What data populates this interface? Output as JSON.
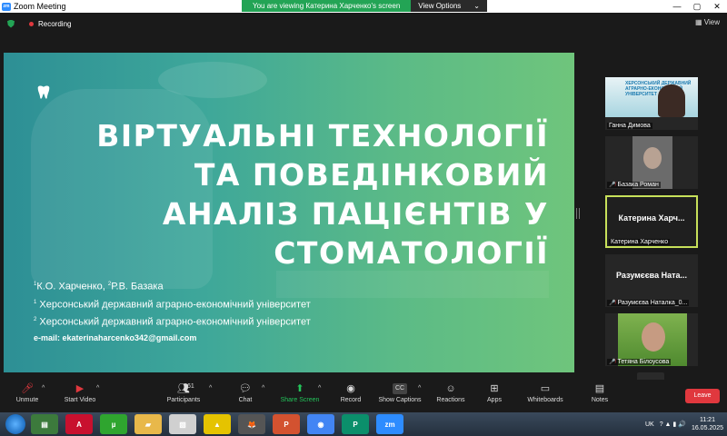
{
  "window": {
    "title": "Zoom Meeting",
    "banner_msg": "You are viewing Катерина Харченко's screen",
    "view_options": "View Options",
    "view_options_caret": "⌄",
    "zoom_logo": "zm",
    "controls": [
      "—",
      "▢",
      "✕"
    ]
  },
  "topbar": {
    "recording_label": "Recording",
    "view_btn": "View"
  },
  "slide": {
    "title_lines": [
      "ВІРТУАЛЬНІ ТЕХНОЛОГІЇ",
      "ТА ПОВЕДІНКОВИЙ",
      "АНАЛІЗ ПАЦІЄНТІВ У",
      "СТОМАТОЛОГІЇ"
    ],
    "authors_line": {
      "sup1": "1",
      "author1": "К.О. Харченко,",
      "sup2": "2",
      "author2": "Р.В. Базака"
    },
    "affiliations": [
      {
        "sup": "1",
        "text": " Херсонський державний аграрно-економічний університет"
      },
      {
        "sup": "2",
        "text": " Херсонський державний аграрно-економічний університет"
      }
    ],
    "email": "e-mail: ekaterinaharcenko342@gmail.com"
  },
  "participants": [
    {
      "name": "Ганна Димова",
      "muted": false,
      "type": "photo1",
      "photo_text": "ХЕРСОНСЬКИЙ ДЕРЖАВНИЙ\nАГРАРНО-ЕКОНОМІЧНИЙ\nУНІВЕРСИТЕТ"
    },
    {
      "name": "Базака Роман",
      "muted": true,
      "type": "photo2"
    },
    {
      "name": "Катерина Харченко",
      "big": "Катерина  Харч...",
      "muted": false,
      "type": "active"
    },
    {
      "name": "Разумєєва Наталка_0...",
      "big": "Разумєєва  Ната...",
      "muted": true,
      "type": "text"
    },
    {
      "name": "Тетяна Білоусова",
      "muted": true,
      "type": "photo3"
    }
  ],
  "participants_mic_icon": "🎤̸",
  "participants_scroll": "⌄",
  "toolbar": {
    "unmute": "Unmute",
    "start_video": "Start Video",
    "participants": "Participants",
    "participants_count": "61",
    "chat": "Chat",
    "share_screen": "Share Screen",
    "record": "Record",
    "show_captions": "Show Captions",
    "captions_icon": "CC",
    "reactions": "Reactions",
    "apps": "Apps",
    "whiteboards": "Whiteboards",
    "notes": "Notes",
    "leave": "Leave",
    "caret": "^"
  },
  "taskbar": {
    "apps": [
      {
        "name": "monitor",
        "label": "▤",
        "color": "#3c7a3c"
      },
      {
        "name": "acrobat",
        "label": "A",
        "color": "#c8102e"
      },
      {
        "name": "utorrent",
        "label": "µ",
        "color": "#2fa52f"
      },
      {
        "name": "explorer",
        "label": "▰",
        "color": "#e8b84a"
      },
      {
        "name": "paint",
        "label": "▧",
        "color": "#d0d0d0"
      },
      {
        "name": "triangle",
        "label": "▲",
        "color": "#e5c300"
      },
      {
        "name": "fox",
        "label": "🦊",
        "color": "#555555"
      },
      {
        "name": "powerpoint-red",
        "label": "P",
        "color": "#d35230"
      },
      {
        "name": "chrome",
        "label": "◉",
        "color": "#4285f4"
      },
      {
        "name": "publisher",
        "label": "P",
        "color": "#0b8f6b"
      },
      {
        "name": "zoom",
        "label": "zm",
        "color": "#2d8cff"
      }
    ],
    "lang": "UK",
    "tray_icons": "? ▲ ▮ 🔊",
    "time": "11:21",
    "date": "16.05.2025"
  },
  "colors": {
    "accent_green": "#23a455",
    "leave_red": "#e0383e",
    "active_border": "#c7e05a"
  }
}
